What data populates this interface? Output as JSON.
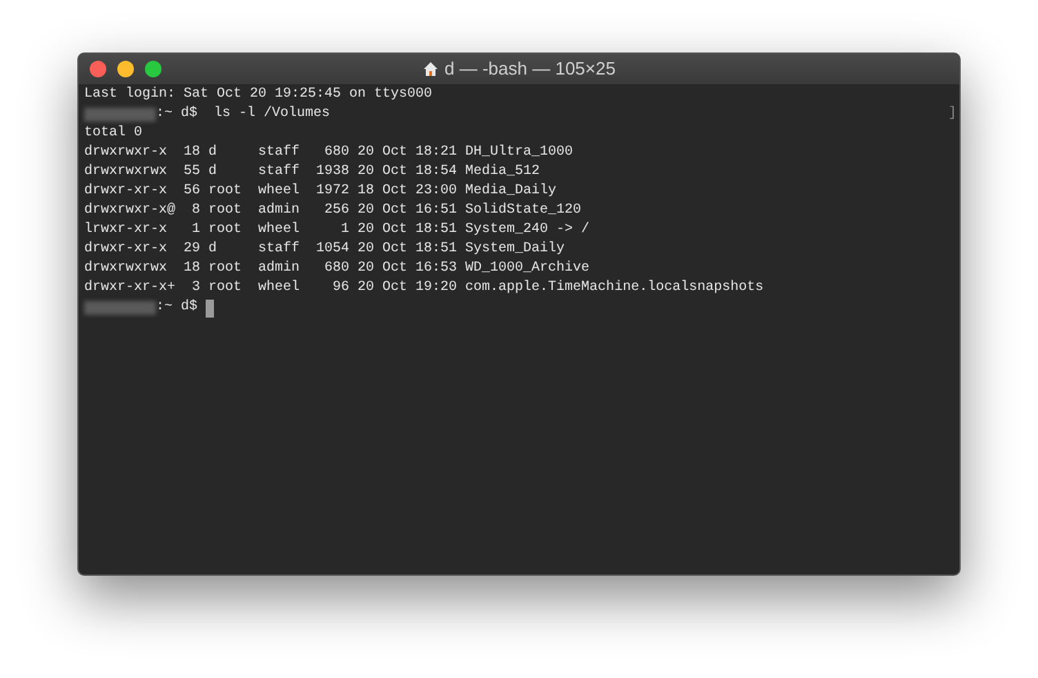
{
  "window": {
    "title": "d — -bash — 105×25"
  },
  "terminal": {
    "lines": [
      {
        "kind": "output",
        "text": "Last login: Sat Oct 20 19:25:45 on ttys000"
      },
      {
        "kind": "prompt",
        "text": ":~ d$  ls -l /Volumes",
        "cursor": false
      },
      {
        "kind": "output",
        "text": "total 0"
      },
      {
        "kind": "output",
        "text": "drwxrwxr-x  18 d     staff   680 20 Oct 18:21 DH_Ultra_1000"
      },
      {
        "kind": "output",
        "text": "drwxrwxrwx  55 d     staff  1938 20 Oct 18:54 Media_512"
      },
      {
        "kind": "output",
        "text": "drwxr-xr-x  56 root  wheel  1972 18 Oct 23:00 Media_Daily"
      },
      {
        "kind": "output",
        "text": "drwxrwxr-x@  8 root  admin   256 20 Oct 16:51 SolidState_120"
      },
      {
        "kind": "output",
        "text": "lrwxr-xr-x   1 root  wheel     1 20 Oct 18:51 System_240 -> /"
      },
      {
        "kind": "output",
        "text": "drwxr-xr-x  29 d     staff  1054 20 Oct 18:51 System_Daily"
      },
      {
        "kind": "output",
        "text": "drwxrwxrwx  18 root  admin   680 20 Oct 16:53 WD_1000_Archive"
      },
      {
        "kind": "output",
        "text": "drwxr-xr-x+  3 root  wheel    96 20 Oct 19:20 com.apple.TimeMachine.localsnapshots"
      },
      {
        "kind": "prompt",
        "text": ":~ d$",
        "cursor": true
      }
    ],
    "edge_mark": "]"
  }
}
